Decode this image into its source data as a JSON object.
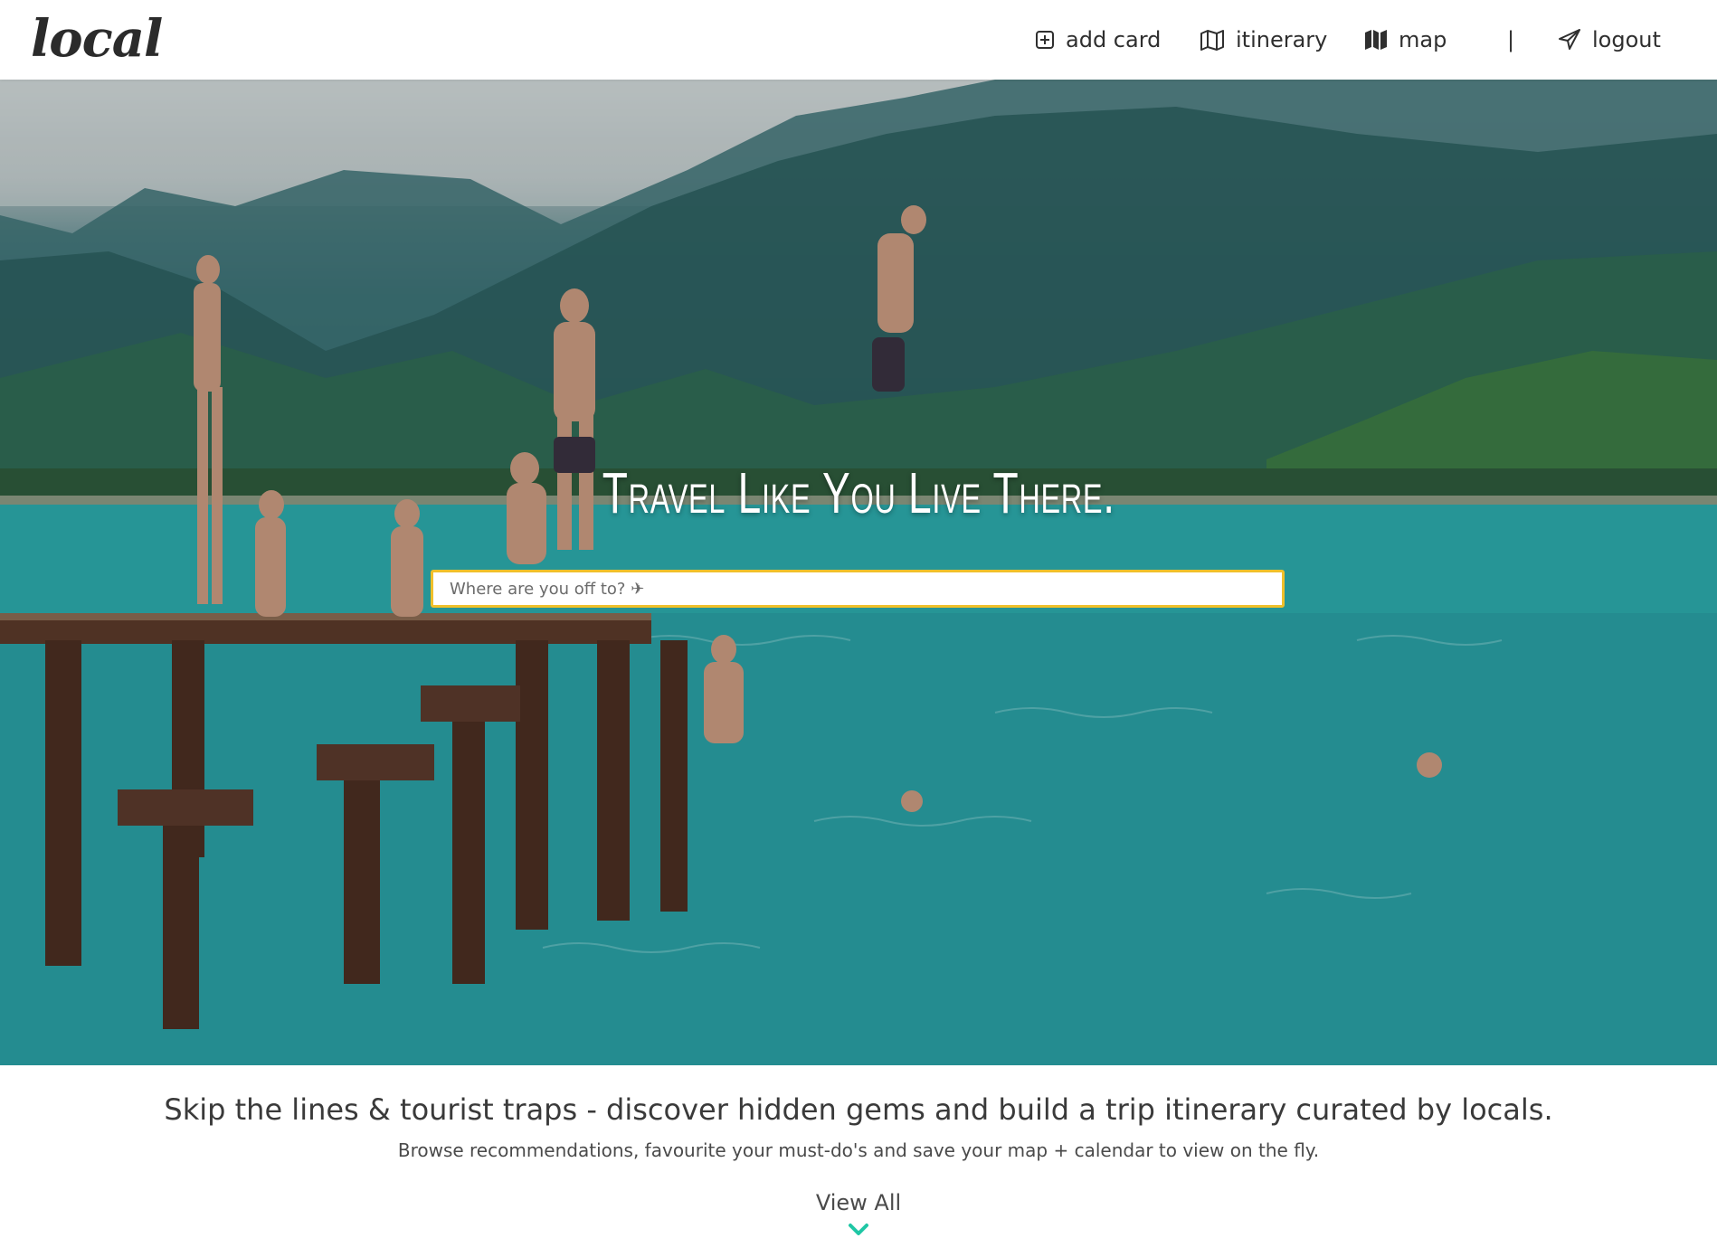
{
  "app": {
    "logo_text": "local"
  },
  "nav": {
    "add_card": "add card",
    "itinerary": "itinerary",
    "map": "map",
    "separator": "|",
    "logout": "logout"
  },
  "hero": {
    "headline": "Travel Like You Live There.",
    "search_placeholder": "Where are you off to? ✈"
  },
  "intro": {
    "tagline": "Skip the lines & tourist traps - discover hidden gems and build a trip itinerary curated by locals.",
    "subline": "Browse recommendations, favourite your must-do's and save your map + calendar to view on the fly.",
    "view_all": "View All"
  },
  "colors": {
    "search_border": "#f0c02a",
    "chevron": "#1fc7a5",
    "text_dark": "#3a3a3a"
  },
  "icons": [
    "plus-square-icon",
    "map-outline-icon",
    "map-filled-icon",
    "paper-plane-icon",
    "chevron-down-icon"
  ]
}
